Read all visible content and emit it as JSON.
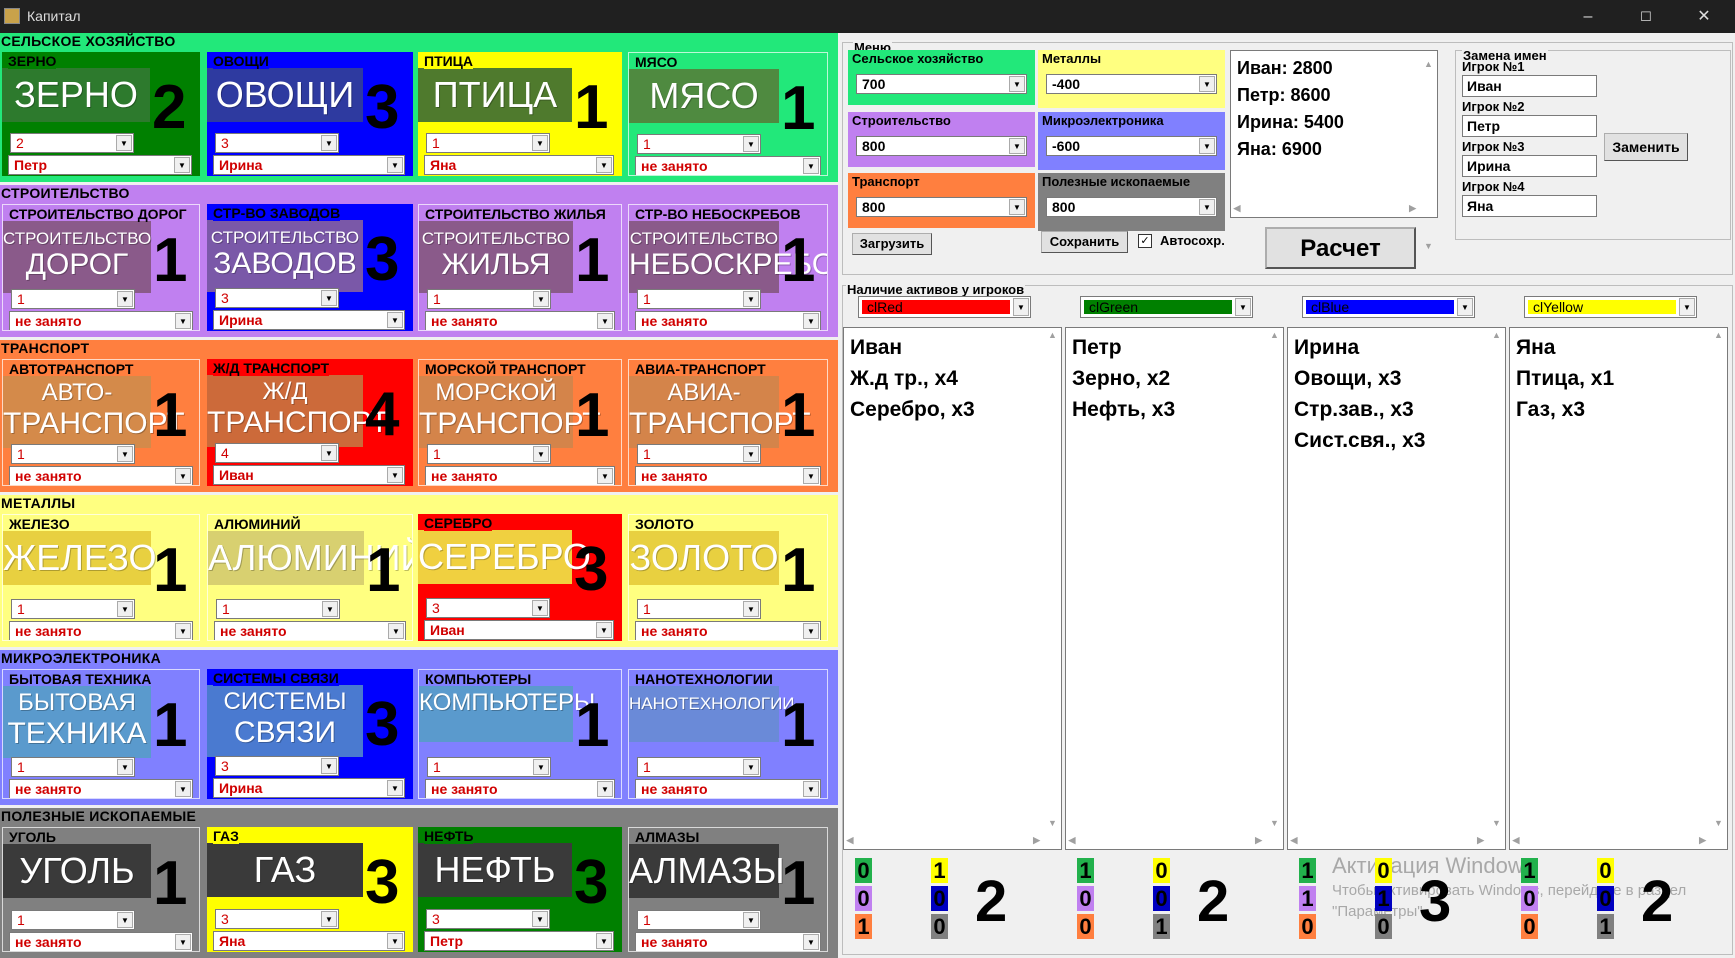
{
  "window": {
    "title": "Капитал",
    "minimize": "–",
    "maximize": "☐",
    "close": "✕"
  },
  "sectors": [
    {
      "id": "agri",
      "title": "СЕЛЬСКОЕ ХОЗЯЙСТВО",
      "bg": "#22e87a",
      "tiles": [
        {
          "label": "ЗЕРНО",
          "label_bg": "#008000",
          "tile_bg": "#008000",
          "img_text": "ЗЕРНО",
          "img_bg": "#2d7a2d",
          "count": "2",
          "level": "2",
          "owner": "Петр"
        },
        {
          "label": "ОВОЩИ",
          "label_bg": "#0000ff",
          "tile_bg": "#0000ff",
          "img_text": "ОВОЩИ",
          "img_bg": "#2e3aa0",
          "count": "3",
          "level": "3",
          "owner": "Ирина"
        },
        {
          "label": "ПТИЦА",
          "label_bg": "#ffff00",
          "tile_bg": "#ffff00",
          "img_text": "ПТИЦА",
          "img_bg": "#4f7a2d",
          "count": "1",
          "level": "1",
          "owner": "Яна"
        },
        {
          "label": "МЯСО",
          "label_bg": "#22e87a",
          "tile_bg": "#22e87a",
          "img_text": "МЯСО",
          "img_bg": "#4f8a40",
          "count": "1",
          "level": "1",
          "owner": "не занято"
        }
      ]
    },
    {
      "id": "build",
      "title": "СТРОИТЕЛЬСТВО",
      "bg": "#c080f0",
      "tiles": [
        {
          "label": "СТРОИТЕЛЬСТВО ДОРОГ",
          "label_bg": "#c080f0",
          "tile_bg": "#c080f0",
          "img_text1": "СТРОИТЕЛЬСТВО",
          "img_text": "ДОРОГ",
          "img_bg": "#8a5a8a",
          "count": "1",
          "level": "1",
          "owner": "не занято"
        },
        {
          "label": "СТР-ВО ЗАВОДОВ",
          "label_bg": "#0000ff",
          "tile_bg": "#0000ff",
          "img_text1": "СТРОИТЕЛЬСТВО",
          "img_text": "ЗАВОДОВ",
          "img_bg": "#7a58a8",
          "count": "3",
          "level": "3",
          "owner": "Ирина"
        },
        {
          "label": "СТРОИТЕЛЬСТВО ЖИЛЬЯ",
          "label_bg": "#c080f0",
          "tile_bg": "#c080f0",
          "img_text1": "СТРОИТЕЛЬСТВО",
          "img_text": "ЖИЛЬЯ",
          "img_bg": "#8a5a8a",
          "count": "1",
          "level": "1",
          "owner": "не занято"
        },
        {
          "label": "СТР-ВО НЕБОСКРЕБОВ",
          "label_bg": "#c080f0",
          "tile_bg": "#c080f0",
          "img_text1": "СТРОИТЕЛЬСТВО",
          "img_text": "НЕБОСКРЕБОВ",
          "img_bg": "#8a5a8a",
          "count": "1",
          "level": "1",
          "owner": "не занято"
        }
      ]
    },
    {
      "id": "transport",
      "title": "ТРАНСПОРТ",
      "bg": "#ff7f3f",
      "tiles": [
        {
          "label": "АВТОТРАНСПОРТ",
          "label_bg": "#ff7f3f",
          "tile_bg": "#ff7f3f",
          "img_text1": "АВТО-",
          "img_text": "ТРАНСПОРТ",
          "img_bg": "#d48a4a",
          "count": "1",
          "level": "1",
          "owner": "не занято"
        },
        {
          "label": "Ж/Д ТРАНСПОРТ",
          "label_bg": "#ff0000",
          "tile_bg": "#ff0000",
          "img_text1": "Ж/Д",
          "img_text": "ТРАНСПОРТ",
          "img_bg": "#cc6a3a",
          "count": "4",
          "level": "4",
          "owner": "Иван"
        },
        {
          "label": "МОРСКОЙ ТРАНСПОРТ",
          "label_bg": "#ff7f3f",
          "tile_bg": "#ff7f3f",
          "img_text1": "МОРСКОЙ",
          "img_text": "ТРАНСПОРТ",
          "img_bg": "#d4844a",
          "count": "1",
          "level": "1",
          "owner": "не занято"
        },
        {
          "label": "АВИА-ТРАНСПОРТ",
          "label_bg": "#ff7f3f",
          "tile_bg": "#ff7f3f",
          "img_text1": "АВИА-",
          "img_text": "ТРАНСПОРТ",
          "img_bg": "#d4844a",
          "count": "1",
          "level": "1",
          "owner": "не занято"
        }
      ]
    },
    {
      "id": "metals",
      "title": "МЕТАЛЛЫ",
      "bg": "#ffff80",
      "tiles": [
        {
          "label": "ЖЕЛЕЗО",
          "label_bg": "#ffff80",
          "tile_bg": "#ffff80",
          "img_text": "ЖЕЛЕЗО",
          "img_bg": "#e8d040",
          "count": "1",
          "level": "1",
          "owner": "не занято"
        },
        {
          "label": "АЛЮМИНИЙ",
          "label_bg": "#ffff80",
          "tile_bg": "#ffff80",
          "img_text": "АЛЮМИНИЙ",
          "img_bg": "#d8d070",
          "count": "1",
          "level": "1",
          "owner": "не занято"
        },
        {
          "label": "СЕРЕБРО",
          "label_bg": "#ff0000",
          "tile_bg": "#ff0000",
          "img_text": "СЕРЕБРО",
          "img_bg": "#f0d040",
          "count": "3",
          "level": "3",
          "owner": "Иван"
        },
        {
          "label": "ЗОЛОТО",
          "label_bg": "#ffff80",
          "tile_bg": "#ffff80",
          "img_text": "ЗОЛОТО",
          "img_bg": "#e8d040",
          "count": "1",
          "level": "1",
          "owner": "не занято"
        }
      ]
    },
    {
      "id": "micro",
      "title": "МИКРОЭЛЕКТРОНИКА",
      "bg": "#8080ff",
      "tiles": [
        {
          "label": "БЫТОВАЯ ТЕХНИКА",
          "label_bg": "#8080ff",
          "tile_bg": "#8080ff",
          "img_text1": "БЫТОВАЯ",
          "img_text": "ТЕХНИКА",
          "img_bg": "#5a9acd",
          "count": "1",
          "level": "1",
          "owner": "не занято"
        },
        {
          "label": "СИСТЕМЫ СВЯЗИ",
          "label_bg": "#0000ff",
          "tile_bg": "#0000ff",
          "img_text1": "СИСТЕМЫ",
          "img_text": "СВЯЗИ",
          "img_bg": "#4a7ad0",
          "count": "3",
          "level": "3",
          "owner": "Ирина"
        },
        {
          "label": "КОМПЬЮТЕРЫ",
          "label_bg": "#8080ff",
          "tile_bg": "#8080ff",
          "img_text1": "КОМПЬЮТЕРЫ",
          "img_text": "",
          "img_bg": "#5a9acd",
          "count": "1",
          "level": "1",
          "owner": "не занято"
        },
        {
          "label": "НАНОТЕХНОЛОГИИ",
          "label_bg": "#8080ff",
          "tile_bg": "#8080ff",
          "img_text1": "НАНОТЕХНОЛОГИИ",
          "img_text": "",
          "img_bg": "#6a8ad8",
          "count": "1",
          "level": "1",
          "owner": "не занято"
        }
      ]
    },
    {
      "id": "mining",
      "title": "ПОЛЕЗНЫЕ ИСКОПАЕМЫЕ",
      "bg": "#808080",
      "tiles": [
        {
          "label": "УГОЛЬ",
          "label_bg": "#808080",
          "tile_bg": "#808080",
          "img_text": "УГОЛЬ",
          "img_bg": "#3a3a3a",
          "count": "1",
          "level": "1",
          "owner": "не занято"
        },
        {
          "label": "ГАЗ",
          "label_bg": "#ffff00",
          "tile_bg": "#ffff00",
          "img_text": "ГАЗ",
          "img_bg": "#3a3a3a",
          "count": "3",
          "level": "3",
          "owner": "Яна"
        },
        {
          "label": "НЕФТЬ",
          "label_bg": "#008000",
          "tile_bg": "#008000",
          "img_text": "НЕФТЬ",
          "img_bg": "#3a3a3a",
          "count": "3",
          "level": "3",
          "owner": "Петр"
        },
        {
          "label": "АЛМАЗЫ",
          "label_bg": "#808080",
          "tile_bg": "#808080",
          "img_text": "АЛМАЗЫ",
          "img_bg": "#3a3a3a",
          "count": "1",
          "level": "1",
          "owner": "не занято"
        }
      ]
    }
  ],
  "menu": {
    "title": "Меню",
    "boxes": [
      {
        "title": "Сельское хозяйство",
        "value": "700",
        "bg": "#22e87a"
      },
      {
        "title": "Металлы",
        "value": "-400",
        "bg": "#ffff80"
      },
      {
        "title": "Строительство",
        "value": "800",
        "bg": "#c080f0"
      },
      {
        "title": "Микроэлектроника",
        "value": "-600",
        "bg": "#8080ff"
      },
      {
        "title": "Транспорт",
        "value": "800",
        "bg": "#ff7f3f"
      },
      {
        "title": "Полезные ископаемые",
        "value": "800",
        "bg": "#808080"
      }
    ],
    "load_label": "Загрузить",
    "save_label": "Сохранить",
    "autosave_label": "Автосохр.",
    "autosave_checked": true,
    "calc_label": "Расчет",
    "balances": [
      "Иван: 2800",
      "Петр: 8600",
      "Ирина: 5400",
      "Яна: 6900"
    ]
  },
  "rename": {
    "title": "Замена имен",
    "players": [
      {
        "label": "Игрок №1",
        "value": "Иван"
      },
      {
        "label": "Игрок №2",
        "value": "Петр"
      },
      {
        "label": "Игрок №3",
        "value": "Ирина"
      },
      {
        "label": "Игрок №4",
        "value": "Яна"
      }
    ],
    "button": "Заменить"
  },
  "assets": {
    "title": "Наличие активов у игроков",
    "players": [
      {
        "color_name": "clRed",
        "color": "#ff0000",
        "lines": [
          "Иван",
          "Ж.д тр., х4",
          "Серебро, х3"
        ],
        "count": "2",
        "chips": [
          [
            "0",
            "#22b14c"
          ],
          [
            "0",
            "#c080f0"
          ],
          [
            "1",
            "#ff7f3f"
          ],
          [
            "1",
            "#ffff00"
          ],
          [
            "0",
            "#0000c0"
          ],
          [
            "0",
            "#808080"
          ]
        ]
      },
      {
        "color_name": "clGreen",
        "color": "#008000",
        "lines": [
          "Петр",
          "Зерно, х2",
          "Нефть, х3"
        ],
        "count": "2",
        "chips": [
          [
            "1",
            "#22b14c"
          ],
          [
            "0",
            "#c080f0"
          ],
          [
            "0",
            "#ff7f3f"
          ],
          [
            "0",
            "#ffff00"
          ],
          [
            "0",
            "#0000c0"
          ],
          [
            "1",
            "#808080"
          ]
        ]
      },
      {
        "color_name": "clBlue",
        "color": "#0000ff",
        "lines": [
          "Ирина",
          "Овощи, х3",
          "Стр.зав., х3",
          "Сист.свя., х3"
        ],
        "count": "3",
        "chips": [
          [
            "1",
            "#22b14c"
          ],
          [
            "1",
            "#c080f0"
          ],
          [
            "0",
            "#ff7f3f"
          ],
          [
            "0",
            "#ffff00"
          ],
          [
            "1",
            "#0000c0"
          ],
          [
            "0",
            "#808080"
          ]
        ]
      },
      {
        "color_name": "clYellow",
        "color": "#ffff00",
        "lines": [
          "Яна",
          "Птица, х1",
          "Газ, х3"
        ],
        "count": "2",
        "chips": [
          [
            "1",
            "#22b14c"
          ],
          [
            "0",
            "#c080f0"
          ],
          [
            "0",
            "#ff7f3f"
          ],
          [
            "0",
            "#ffff00"
          ],
          [
            "0",
            "#0000c0"
          ],
          [
            "1",
            "#808080"
          ]
        ]
      }
    ]
  },
  "watermark": {
    "line1": "Активация Windows",
    "line2": "Чтобы активировать Windows, перейдите в раздел",
    "line3": "\"Параметры\"."
  }
}
